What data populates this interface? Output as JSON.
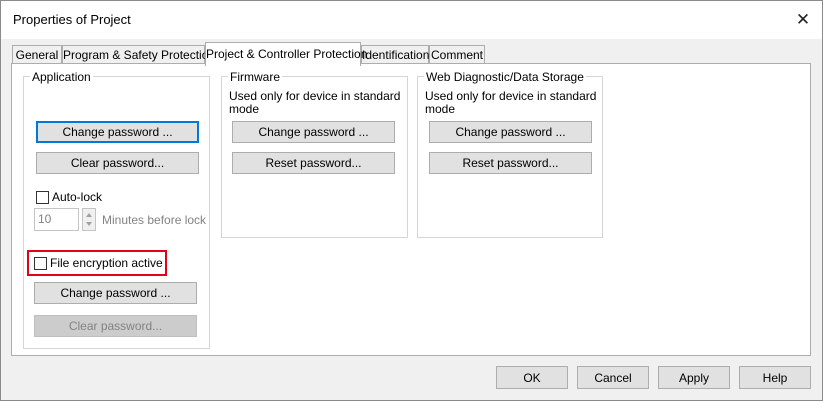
{
  "window": {
    "title": "Properties of Project"
  },
  "tabs": [
    {
      "label": "General"
    },
    {
      "label": "Program & Safety Protection"
    },
    {
      "label": "Project & Controller Protection"
    },
    {
      "label": "Identification"
    },
    {
      "label": "Comment"
    }
  ],
  "application": {
    "title": "Application",
    "change_password": "Change password ...",
    "clear_password": "Clear password...",
    "auto_lock_label": "Auto-lock",
    "minutes_value": "10",
    "minutes_label": "Minutes before lock",
    "encryption_label": "File encryption active",
    "enc_change_password": "Change password ...",
    "enc_clear_password": "Clear password..."
  },
  "firmware": {
    "title": "Firmware",
    "note_line1": "Used only for device in standard",
    "note_line2": "mode",
    "change_password": "Change password ...",
    "reset_password": "Reset password..."
  },
  "webdiag": {
    "title": "Web Diagnostic/Data Storage",
    "note_line1": "Used only for device in standard",
    "note_line2": "mode",
    "change_password": "Change password ...",
    "reset_password": "Reset password..."
  },
  "footer": {
    "ok": "OK",
    "cancel": "Cancel",
    "apply": "Apply",
    "help": "Help"
  },
  "colors": {
    "focus_border": "#0078d7",
    "highlight_box": "#e3001b",
    "dialog_bg": "#f0f0f0"
  },
  "icons": {
    "close": "close-icon",
    "spin_up": "chevron-up-icon",
    "spin_down": "chevron-down-icon"
  },
  "state": {
    "auto_lock_checked": false,
    "encryption_checked": false,
    "active_tab": "Project & Controller Protection"
  }
}
